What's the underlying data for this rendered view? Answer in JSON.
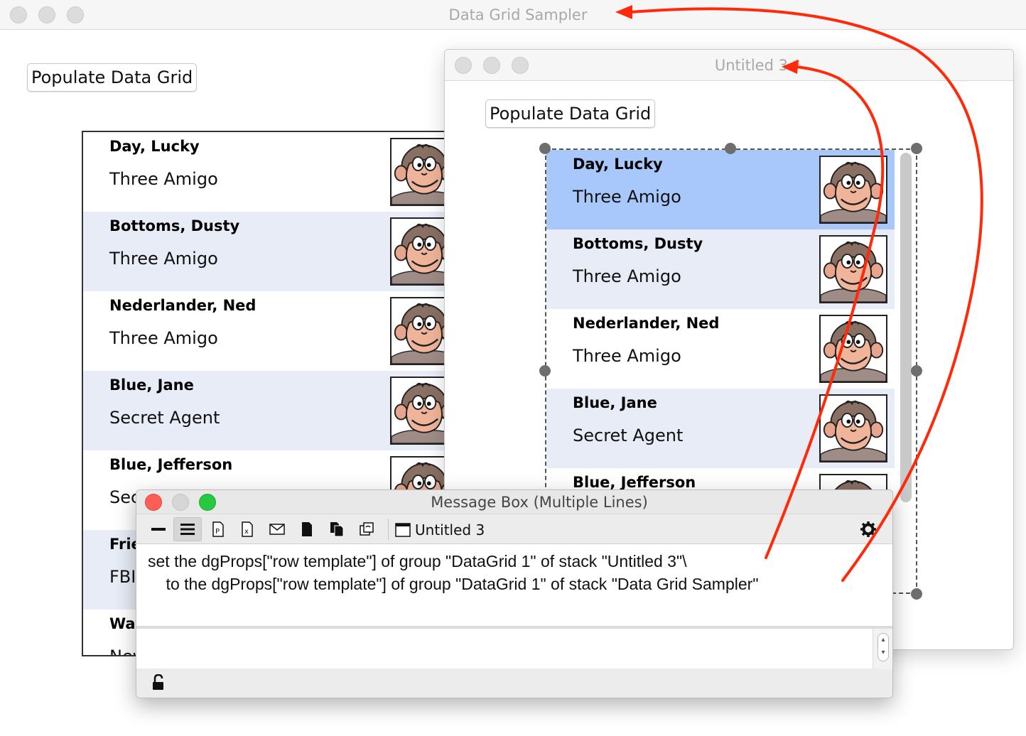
{
  "sampler": {
    "title": "Data Grid Sampler",
    "populate_label": "Populate Data Grid",
    "rows": [
      {
        "name": "Day, Lucky",
        "title": "Three Amigo"
      },
      {
        "name": "Bottoms, Dusty",
        "title": "Three Amigo"
      },
      {
        "name": "Nederlander, Ned",
        "title": "Three Amigo"
      },
      {
        "name": "Blue, Jane",
        "title": "Secret Agent"
      },
      {
        "name": "Blue, Jefferson",
        "title": "Sec"
      },
      {
        "name": "Frie",
        "title": "FBI"
      },
      {
        "name": "Wat",
        "title": "Nev"
      }
    ]
  },
  "untitled": {
    "title": "Untitled 3 *",
    "populate_label": "Populate Data Grid",
    "rows": [
      {
        "name": "Day, Lucky",
        "title": "Three Amigo"
      },
      {
        "name": "Bottoms, Dusty",
        "title": "Three Amigo"
      },
      {
        "name": "Nederlander, Ned",
        "title": "Three Amigo"
      },
      {
        "name": "Blue, Jane",
        "title": "Secret Agent"
      },
      {
        "name": "Blue, Jefferson",
        "title": ""
      }
    ]
  },
  "message_box": {
    "title": "Message Box (Multiple Lines)",
    "target_stack": "Untitled 3",
    "line1": "set the dgProps[\"row template\"] of group \"DataGrid 1\" of stack \"Untitled 3\"\\",
    "line2": "    to the dgProps[\"row template\"] of group \"DataGrid 1\" of stack \"Data Grid Sampler\""
  },
  "icons": {
    "single_line": "single-line-icon",
    "multi_line": "multiple-lines-icon",
    "global_props": "global-properties-icon",
    "global_vars": "global-variables-icon",
    "pending_messages": "pending-messages-icon",
    "front_scripts": "front-scripts-icon",
    "back_scripts": "back-scripts-icon",
    "stacks_in_use": "stacks-in-use-icon",
    "settings": "gear-icon",
    "lock": "unlocked-padlock-icon"
  },
  "colors": {
    "arrow": "#ff2a0a",
    "selected_row": "#a8c8fb",
    "alt_row": "#e7ecf6"
  }
}
